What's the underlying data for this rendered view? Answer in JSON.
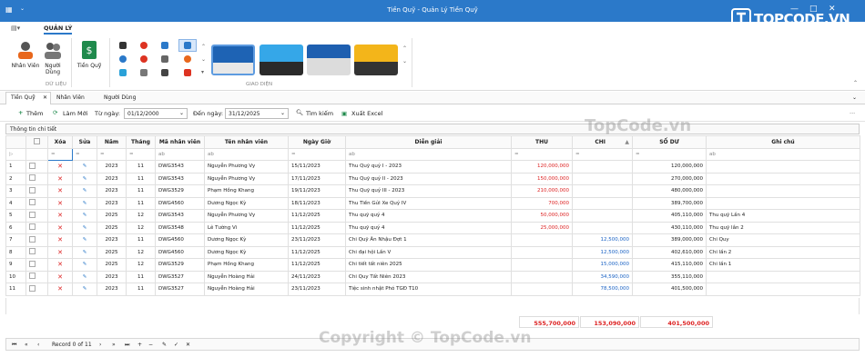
{
  "window": {
    "title": "Tiền Quỹ - Quản Lý Tiền Quỹ",
    "minimize": "—",
    "maximize": "□",
    "close": "✕"
  },
  "brand": {
    "text": "TOPCODE.VN"
  },
  "ribbon_tabs": [
    "QUẢN LÝ"
  ],
  "ribbon": {
    "buttons": [
      {
        "label": "Nhân Viên"
      },
      {
        "label": "Người Dùng"
      },
      {
        "label": "Tiền Quỹ"
      }
    ],
    "group1": "DỮ LIỆU",
    "group2": "GIAO DIỆN"
  },
  "doc_tabs": [
    "Tiền Quỹ",
    "Nhân Viên",
    "Người Dùng"
  ],
  "toolbar": {
    "add": "Thêm",
    "refresh": "Làm Mới",
    "from_label": "Từ ngày:",
    "from_value": "01/12/2000",
    "to_label": "Đến ngày:",
    "to_value": "31/12/2025",
    "search": "Tìm kiếm",
    "export": "Xuất Excel"
  },
  "section_title": "Thông tin chi tiết",
  "columns": [
    "Xóa",
    "Sửa",
    "Năm",
    "Tháng",
    "Mã nhân viên",
    "Tên nhân viên",
    "Ngày Giờ",
    "Diễn giải",
    "THU",
    "CHI",
    "SỐ DƯ",
    "Ghi chú"
  ],
  "rows": [
    {
      "n": "1",
      "year": "2023",
      "month": "11",
      "code": "DWG3543",
      "name": "Nguyễn Phương Vy",
      "date": "15/11/2023",
      "desc": "Thu Quỹ quý I - 2023",
      "thu": "120,000,000",
      "chi": "",
      "du": "120,000,000",
      "note": ""
    },
    {
      "n": "2",
      "year": "2023",
      "month": "11",
      "code": "DWG3543",
      "name": "Nguyễn Phương Vy",
      "date": "17/11/2023",
      "desc": "Thu Quỹ quý II - 2023",
      "thu": "150,000,000",
      "chi": "",
      "du": "270,000,000",
      "note": ""
    },
    {
      "n": "3",
      "year": "2023",
      "month": "11",
      "code": "DWG3529",
      "name": "Phạm Hồng Khang",
      "date": "19/11/2023",
      "desc": "Thu Quỹ quý III - 2023",
      "thu": "210,000,000",
      "chi": "",
      "du": "480,000,000",
      "note": ""
    },
    {
      "n": "4",
      "year": "2023",
      "month": "11",
      "code": "DWG4560",
      "name": "Dương Ngọc Kỳ",
      "date": "18/11/2023",
      "desc": "Thu Tiền Gửi Xe Quý IV",
      "thu": "700,000",
      "chi": "",
      "du": "389,700,000",
      "note": ""
    },
    {
      "n": "5",
      "year": "2025",
      "month": "12",
      "code": "DWG3543",
      "name": "Nguyễn Phương Vy",
      "date": "11/12/2025",
      "desc": "Thu quỹ quý 4",
      "thu": "50,000,000",
      "chi": "",
      "du": "405,110,000",
      "note": "Thu quỹ Lần 4"
    },
    {
      "n": "6",
      "year": "2025",
      "month": "12",
      "code": "DWG3548",
      "name": "Lê Tường Vi",
      "date": "11/12/2025",
      "desc": "Thu quỹ quý 4",
      "thu": "25,000,000",
      "chi": "",
      "du": "430,110,000",
      "note": "Thu quỹ lần 2"
    },
    {
      "n": "7",
      "year": "2023",
      "month": "11",
      "code": "DWG4560",
      "name": "Dương Ngọc Kỳ",
      "date": "23/11/2023",
      "desc": "Chi Quỹ Ăn Nhậu Đợt 1",
      "thu": "",
      "chi": "12,500,000",
      "du": "389,000,000",
      "note": "Chi Quy"
    },
    {
      "n": "8",
      "year": "2025",
      "month": "12",
      "code": "DWG4560",
      "name": "Dương Ngọc Kỳ",
      "date": "11/12/2025",
      "desc": "Chi đại hội Lần V",
      "thu": "",
      "chi": "12,500,000",
      "du": "402,610,000",
      "note": "Chi lần 2"
    },
    {
      "n": "9",
      "year": "2025",
      "month": "12",
      "code": "DWG3529",
      "name": "Phạm Hồng Khang",
      "date": "11/12/2025",
      "desc": "Chi tiết tất niên 2025",
      "thu": "",
      "chi": "15,000,000",
      "du": "415,110,000",
      "note": "Chi lần 1"
    },
    {
      "n": "10",
      "year": "2023",
      "month": "11",
      "code": "DWG3527",
      "name": "Nguyễn Hoàng Hải",
      "date": "24/11/2023",
      "desc": "Chi Quy Tất Niên 2023",
      "thu": "",
      "chi": "34,590,000",
      "du": "355,110,000",
      "note": ""
    },
    {
      "n": "11",
      "year": "2023",
      "month": "11",
      "code": "DWG3527",
      "name": "Nguyễn Hoàng Hải",
      "date": "23/11/2023",
      "desc": "Tiệc sinh nhật Phó TGĐ T10",
      "thu": "",
      "chi": "78,500,000",
      "du": "401,500,000",
      "note": ""
    }
  ],
  "totals": {
    "thu": "555,700,000",
    "chi": "153,090,000",
    "du": "401,500,000"
  },
  "navigator": {
    "record": "Record 0 of 11"
  },
  "watermarks": {
    "top": "TopCode.vn",
    "bottom": "Copyright © TopCode.vn"
  },
  "colors": {
    "accent": "#2b79c9",
    "red": "#d22222",
    "blue": "#1a62c4"
  }
}
